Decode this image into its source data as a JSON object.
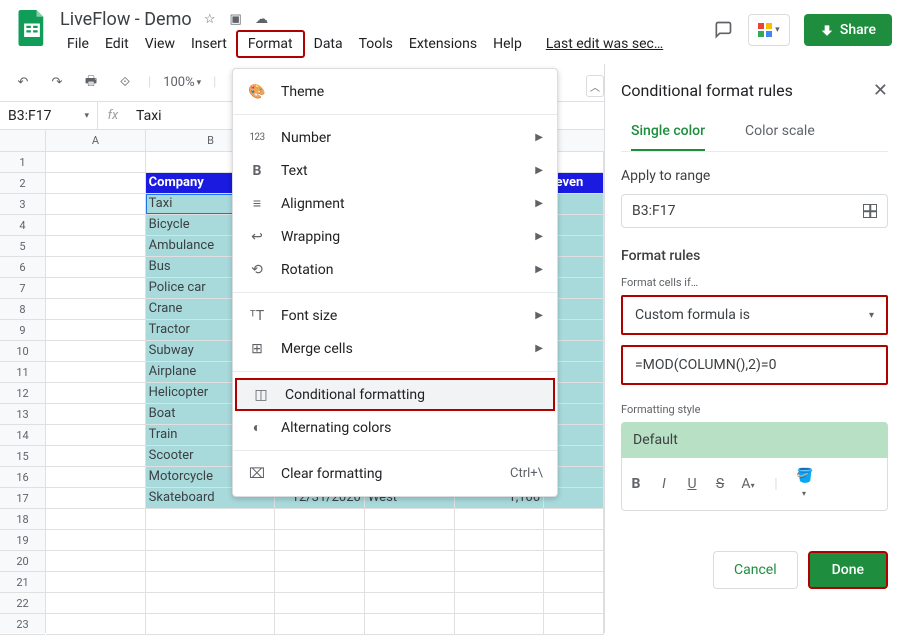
{
  "header": {
    "doc_title": "LiveFlow - Demo",
    "menu": [
      "File",
      "Edit",
      "View",
      "Insert",
      "Format",
      "Data",
      "Tools",
      "Extensions",
      "Help"
    ],
    "last_edit": "Last edit was sec…",
    "share": "Share"
  },
  "toolbar": {
    "zoom": "100%"
  },
  "formula_bar": {
    "namebox": "B3:F17",
    "fx": "fx",
    "value": "Taxi"
  },
  "columns": [
    "A",
    "B"
  ],
  "row_count": 23,
  "sheet": {
    "header_b": "Company",
    "header_f": "Reven",
    "companies": [
      "Taxi",
      "Bicycle",
      "Ambulance",
      "Bus",
      "Police car",
      "Crane",
      "Tractor",
      "Subway",
      "Airplane",
      "Helicopter",
      "Boat",
      "Train",
      "Scooter",
      "Motorcycle",
      "Skateboard"
    ],
    "last_row": {
      "date": "12/31/2020",
      "region": "West",
      "value": "1,100"
    }
  },
  "format_menu": {
    "items": [
      {
        "icon": "🎨",
        "label": "Theme"
      },
      {
        "sep": true
      },
      {
        "icon": "123",
        "label": "Number",
        "arrow": true,
        "icon_style": "font-size:10px;letter-spacing:-0.5px;"
      },
      {
        "icon": "B",
        "label": "Text",
        "arrow": true,
        "icon_style": "font-weight:bold;"
      },
      {
        "icon": "≡",
        "label": "Alignment",
        "arrow": true
      },
      {
        "icon": "↩",
        "label": "Wrapping",
        "arrow": true
      },
      {
        "icon": "⟲",
        "label": "Rotation",
        "arrow": true
      },
      {
        "sep": true
      },
      {
        "icon": "ᵀT",
        "label": "Font size",
        "arrow": true
      },
      {
        "icon": "⊞",
        "label": "Merge cells",
        "arrow": true
      },
      {
        "sep": true
      },
      {
        "icon": "◫",
        "label": "Conditional formatting",
        "highlight": true
      },
      {
        "icon": "◐",
        "label": "Alternating colors"
      },
      {
        "sep": true
      },
      {
        "icon": "⌧",
        "label": "Clear formatting",
        "shortcut": "Ctrl+\\"
      }
    ]
  },
  "sidebar": {
    "title": "Conditional format rules",
    "tabs": [
      "Single color",
      "Color scale"
    ],
    "apply_label": "Apply to range",
    "range": "B3:F17",
    "rules_label": "Format rules",
    "cells_if": "Format cells if…",
    "rule_type": "Custom formula is",
    "formula": "=MOD(COLUMN(),2)=0",
    "style_label": "Formatting style",
    "preview": "Default",
    "cancel": "Cancel",
    "done": "Done"
  }
}
